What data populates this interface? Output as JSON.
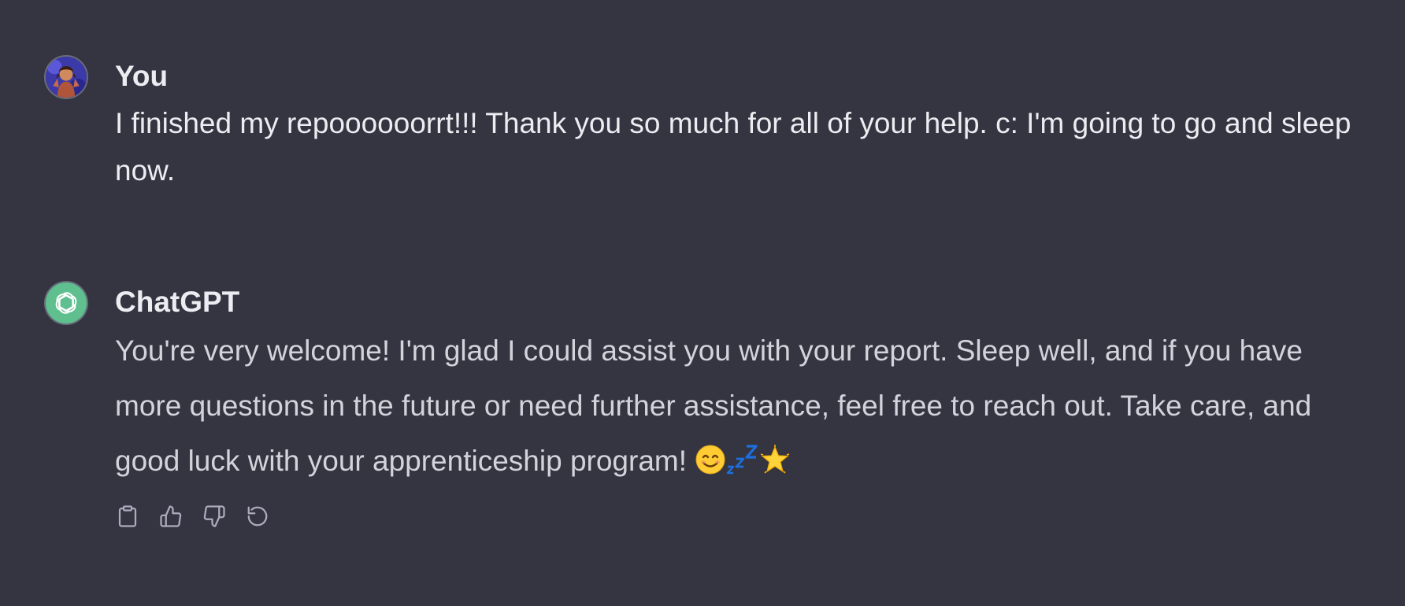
{
  "conversation": {
    "messages": [
      {
        "role": "user",
        "author": "You",
        "text": "I finished my repoooooorrt!!! Thank you so much for all of your help. c: I'm going to go and sleep now."
      },
      {
        "role": "assistant",
        "author": "ChatGPT",
        "text": "You're very welcome! I'm glad I could assist you with your report. Sleep well, and if you have more questions in the future or need further assistance, feel free to reach out. Take care, and good luck with your apprenticeship program! ",
        "emojis": [
          "smiling-face-emoji",
          "zzz-emoji",
          "glowing-star-emoji"
        ]
      }
    ],
    "actions": [
      {
        "name": "copy",
        "icon": "clipboard-icon"
      },
      {
        "name": "thumbs-up",
        "icon": "thumbs-up-icon"
      },
      {
        "name": "thumbs-down",
        "icon": "thumbs-down-icon"
      },
      {
        "name": "regenerate",
        "icon": "regenerate-icon"
      }
    ]
  },
  "colors": {
    "background": "#343541",
    "author_text": "#ececf1",
    "assistant_text": "#d1d5db",
    "icon": "#acacbe",
    "chatgpt_avatar": "#19c37d"
  }
}
